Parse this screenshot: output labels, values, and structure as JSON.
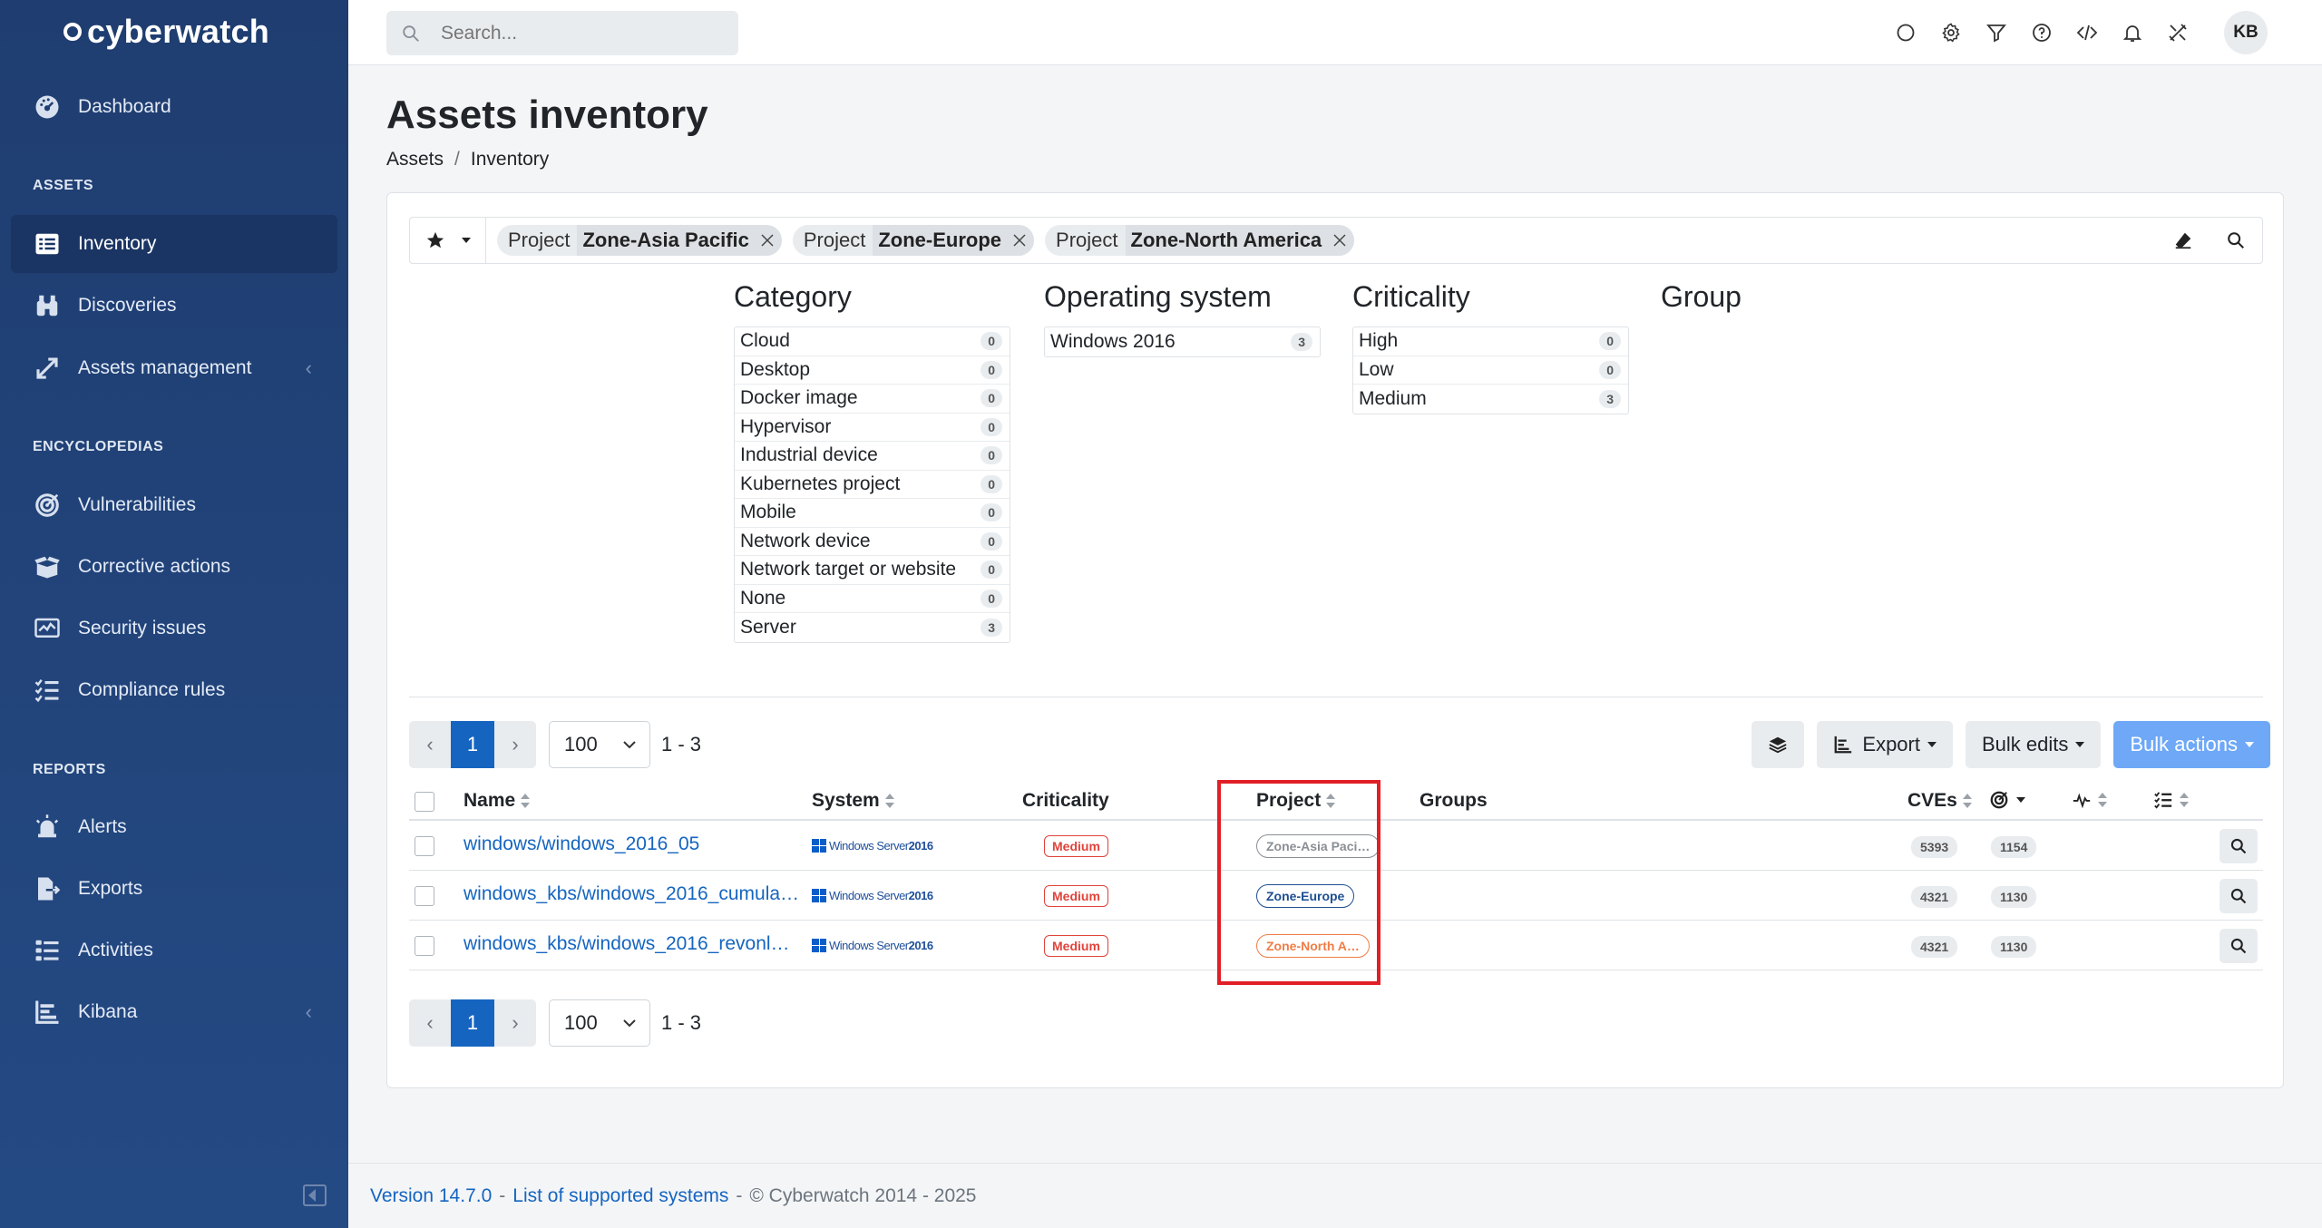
{
  "app": {
    "logo": "cyberwatch"
  },
  "sidebar": {
    "dashboard": "Dashboard",
    "sections": {
      "assets": "ASSETS",
      "encyclopedias": "ENCYCLOPEDIAS",
      "reports": "REPORTS"
    },
    "items": {
      "inventory": "Inventory",
      "discoveries": "Discoveries",
      "assets_management": "Assets management",
      "vulnerabilities": "Vulnerabilities",
      "corrective_actions": "Corrective actions",
      "security_issues": "Security issues",
      "compliance_rules": "Compliance rules",
      "alerts": "Alerts",
      "exports": "Exports",
      "activities": "Activities",
      "kibana": "Kibana"
    },
    "chevron": "‹"
  },
  "topbar": {
    "search_placeholder": "Search...",
    "avatar": "KB"
  },
  "page": {
    "title": "Assets inventory",
    "breadcrumb": [
      "Assets",
      "Inventory"
    ],
    "breadcrumb_sep": "/"
  },
  "filters": {
    "chips": [
      {
        "key": "Project",
        "value": "Zone-Asia Pacific"
      },
      {
        "key": "Project",
        "value": "Zone-Europe"
      },
      {
        "key": "Project",
        "value": "Zone-North America"
      }
    ]
  },
  "facets": {
    "category": {
      "title": "Category",
      "rows": [
        {
          "label": "Cloud",
          "count": "0"
        },
        {
          "label": "Desktop",
          "count": "0"
        },
        {
          "label": "Docker image",
          "count": "0"
        },
        {
          "label": "Hypervisor",
          "count": "0"
        },
        {
          "label": "Industrial device",
          "count": "0"
        },
        {
          "label": "Kubernetes project",
          "count": "0"
        },
        {
          "label": "Mobile",
          "count": "0"
        },
        {
          "label": "Network device",
          "count": "0"
        },
        {
          "label": "Network target or website",
          "count": "0"
        },
        {
          "label": "None",
          "count": "0"
        },
        {
          "label": "Server",
          "count": "3"
        }
      ]
    },
    "os": {
      "title": "Operating system",
      "rows": [
        {
          "label": "Windows 2016",
          "count": "3"
        }
      ]
    },
    "criticality": {
      "title": "Criticality",
      "rows": [
        {
          "label": "High",
          "count": "0"
        },
        {
          "label": "Low",
          "count": "0"
        },
        {
          "label": "Medium",
          "count": "3"
        }
      ]
    },
    "group": {
      "title": "Group"
    }
  },
  "pagination": {
    "prev": "‹",
    "current": "1",
    "next": "›",
    "per_page": "100",
    "range": "1 - 3"
  },
  "toolbar": {
    "export": "Export",
    "bulk_edits": "Bulk edits",
    "bulk_actions": "Bulk actions"
  },
  "table": {
    "headers": {
      "name": "Name",
      "system": "System",
      "criticality": "Criticality",
      "project": "Project",
      "groups": "Groups",
      "cves": "CVEs"
    },
    "rows": [
      {
        "name": "windows/windows_2016_05",
        "system_a": "Windows Server",
        "system_b": "2016",
        "criticality": "Medium",
        "project": "Zone-Asia Paci…",
        "project_color": "#8a8f95",
        "cves": "5393",
        "second": "1154"
      },
      {
        "name": "windows_kbs/windows_2016_cumula…",
        "system_a": "Windows Server",
        "system_b": "2016",
        "criticality": "Medium",
        "project": "Zone-Europe",
        "project_color": "#1d4f91",
        "cves": "4321",
        "second": "1130"
      },
      {
        "name": "windows_kbs/windows_2016_revonl…",
        "system_a": "Windows Server",
        "system_b": "2016",
        "criticality": "Medium",
        "project": "Zone-North A…",
        "project_color": "#f07d47",
        "cves": "4321",
        "second": "1130"
      }
    ]
  },
  "footer": {
    "version": "Version 14.7.0",
    "supported": "List of supported systems",
    "copyright": "© Cyberwatch 2014 - 2025",
    "dash": "-"
  }
}
